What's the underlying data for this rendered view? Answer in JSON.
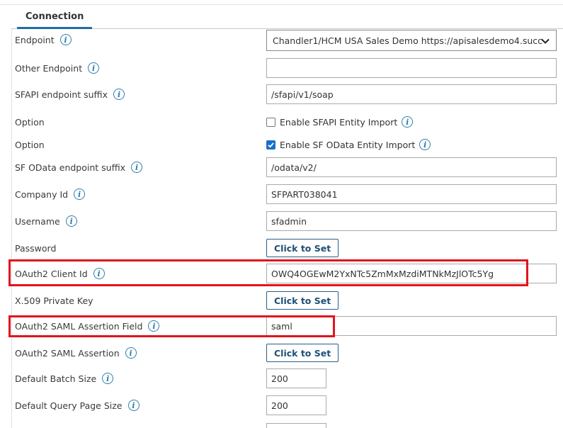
{
  "tab": {
    "label": "Connection"
  },
  "fields": {
    "endpoint": {
      "label": "Endpoint",
      "value": "Chandler1/HCM USA Sales Demo https://apisalesdemo4.succ"
    },
    "other_endpoint": {
      "label": "Other Endpoint",
      "value": ""
    },
    "sfapi_suffix": {
      "label": "SFAPI endpoint suffix",
      "value": "/sfapi/v1/soap"
    },
    "option1": {
      "label": "Option",
      "checkbox_label": "Enable SFAPI Entity Import",
      "checked": false
    },
    "option2": {
      "label": "Option",
      "checkbox_label": "Enable SF OData Entity Import",
      "checked": true
    },
    "odata_suffix": {
      "label": "SF OData endpoint suffix",
      "value": "/odata/v2/"
    },
    "company_id": {
      "label": "Company Id",
      "value": "SFPART038041"
    },
    "username": {
      "label": "Username",
      "value": "sfadmin"
    },
    "password": {
      "label": "Password",
      "button": "Click to Set"
    },
    "oauth_client_id": {
      "label": "OAuth2 Client Id",
      "value": "OWQ4OGEwM2YxNTc5ZmMxMzdiMTNkMzJlOTc5Yg"
    },
    "x509_key": {
      "label": "X.509 Private Key",
      "button": "Click to Set"
    },
    "saml_field": {
      "label": "OAuth2 SAML Assertion Field",
      "value": "saml"
    },
    "saml_assertion": {
      "label": "OAuth2 SAML Assertion",
      "button": "Click to Set"
    },
    "batch_size": {
      "label": "Default Batch Size",
      "value": "200"
    },
    "query_page_size": {
      "label": "Default Query Page Size",
      "value": "200"
    }
  },
  "icons": {
    "info": "info-icon",
    "dropdown": "chevron-down-icon",
    "checkmark": "checkmark-icon"
  },
  "colors": {
    "highlight": "#e0141e",
    "accent": "#1f6ea6",
    "checkbox": "#1a6fc9"
  }
}
